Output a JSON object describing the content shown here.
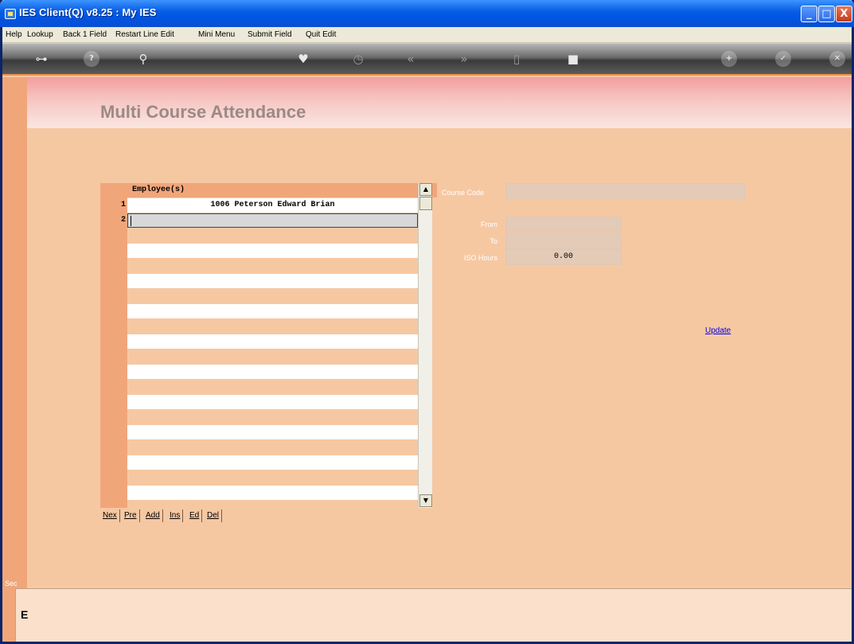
{
  "window": {
    "title": "IES Client(Q) v8.25 : My IES",
    "buttons": {
      "minimize": "_",
      "maximize": "□",
      "close": "X"
    }
  },
  "menu": {
    "items": [
      "Help",
      "Lookup",
      "Back 1 Field",
      "Restart Line Edit",
      "Mini Menu",
      "Submit Field",
      "Quit Edit"
    ]
  },
  "toolbar": {
    "icons": [
      {
        "name": "key-icon",
        "glyph": "⊶"
      },
      {
        "name": "help-icon",
        "glyph": "?"
      },
      {
        "name": "search-icon",
        "glyph": "⚲"
      },
      {
        "name": "heart-icon",
        "glyph": "♥"
      },
      {
        "name": "clock-icon",
        "glyph": "◷"
      },
      {
        "name": "rewind-icon",
        "glyph": "«"
      },
      {
        "name": "fast-forward-icon",
        "glyph": "»"
      },
      {
        "name": "document-icon",
        "glyph": "▯"
      },
      {
        "name": "stop-icon",
        "glyph": "■"
      },
      {
        "name": "add-icon",
        "glyph": "+"
      },
      {
        "name": "confirm-icon",
        "glyph": "✓"
      },
      {
        "name": "cancel-icon",
        "glyph": "✕"
      }
    ]
  },
  "page": {
    "title": "Multi Course Attendance"
  },
  "grid": {
    "header": "Employee(s)",
    "rows": [
      {
        "num": "1",
        "value": "1006 Peterson Edward Brian"
      },
      {
        "num": "2",
        "value": ""
      }
    ],
    "buttons": [
      "Nex",
      "Pre",
      "Add",
      "Ins",
      "Ed",
      "Del"
    ]
  },
  "form": {
    "course_code_label": "Course Code",
    "course_code_value": "",
    "from_label": "From",
    "from_value": "",
    "to_label": "To",
    "to_value": "",
    "iso_hours_label": "ISO Hours",
    "iso_hours_value": "0.00",
    "update_label": "Update"
  },
  "status": {
    "sec_text": "Sec",
    "glyph": "E"
  },
  "colors": {
    "background": "#f6c8a2",
    "accent": "#f1a67a",
    "title_text": "#9b8a86",
    "link": "#0000ee"
  }
}
